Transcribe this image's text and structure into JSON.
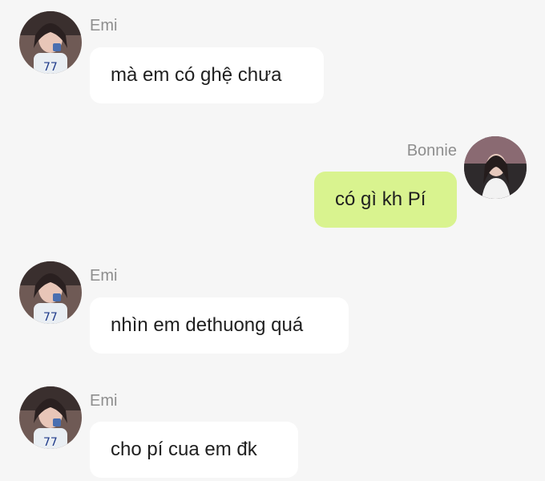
{
  "messages": [
    {
      "sender": "Emi",
      "text": "mà em có ghệ chưa",
      "direction": "incoming"
    },
    {
      "sender": "Bonnie",
      "text": "có gì kh Pí",
      "direction": "outgoing"
    },
    {
      "sender": "Emi",
      "text": "nhìn em dethuong quá",
      "direction": "incoming"
    },
    {
      "sender": "Emi",
      "text": "cho pí cua em đk",
      "direction": "incoming"
    }
  ],
  "colors": {
    "background": "#f6f6f6",
    "incoming_bubble": "#ffffff",
    "outgoing_bubble": "#d9f38f",
    "sender_name": "#8e8e8e",
    "message_text": "#1f1f1f"
  }
}
